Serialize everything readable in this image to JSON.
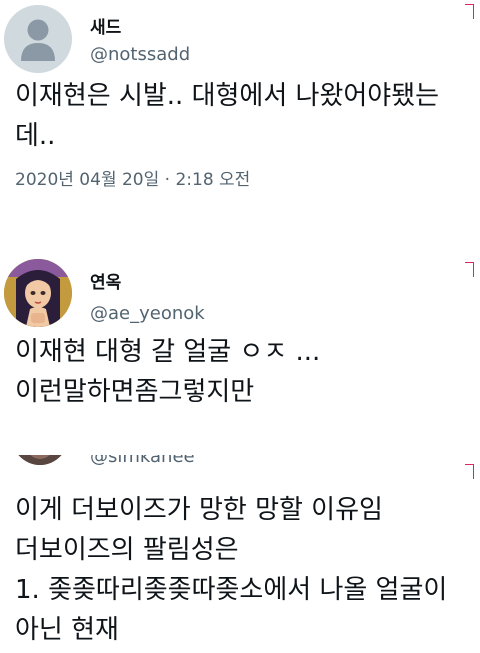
{
  "tweets": [
    {
      "display_name": "새드",
      "handle": "@notssadd",
      "lines": [
        "이재현은 시발.. 대형에서 나왔어야됐는",
        "데.."
      ],
      "timestamp": "2020년 04월 20일 · 2:18 오전"
    },
    {
      "display_name": "연옥",
      "handle": "@ae_yeonok",
      "lines": [
        "이재현 대형 갈 얼굴 ㅇㅈ ...",
        "이런말하면좀그렇지만"
      ]
    },
    {
      "handle": "@simkahee",
      "lines": [
        "이게 더보이즈가 망한 망할 이유임",
        "더보이즈의 팔림성은",
        "1. 좆좆따리좆좆따좆소에서 나올 얼굴이",
        "아닌 현재"
      ]
    }
  ],
  "colors": {
    "text": "#0f1419",
    "secondary": "#536471",
    "default_avatar_bg": "#cfd9de",
    "corner_mark": "#e0245e"
  }
}
